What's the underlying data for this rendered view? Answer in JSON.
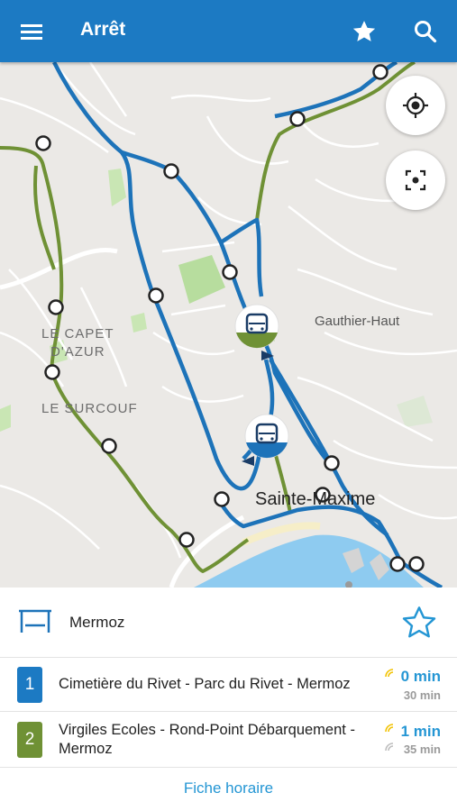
{
  "appbar": {
    "title": "Arrêt",
    "menu_icon": "hamburger-menu-icon",
    "favorite_icon": "star-icon",
    "search_icon": "search-icon"
  },
  "map": {
    "labels": {
      "capet_1": "LE CAPET",
      "capet_2": "D'AZUR",
      "surcouf": "LE SURCOUF",
      "gauthier": "Gauthier-Haut",
      "town": "Sainte-Maxime"
    },
    "locate_icon": "my-location-icon",
    "recenter_icon": "recenter-icon",
    "colors": {
      "line1": "#1d73b9",
      "line2": "#6f9135",
      "water": "#8ecbf0",
      "park": "#b7dd9e"
    }
  },
  "stop": {
    "name": "Mermoz",
    "icon": "bus-stop-icon",
    "favorite_icon": "star-outline-icon"
  },
  "lines": [
    {
      "number": "1",
      "color": "#1c7ac3",
      "name": "Cimetière du Rivet - Parc du Rivet - Mermoz",
      "next": "0 min",
      "then": "30 min"
    },
    {
      "number": "2",
      "color": "#6f9135",
      "name": "Virgiles Ecoles - Rond-Point Débarquement - Mermoz",
      "next": "1 min",
      "then": "35 min"
    }
  ],
  "footer": {
    "timetable_label": "Fiche horaire"
  }
}
